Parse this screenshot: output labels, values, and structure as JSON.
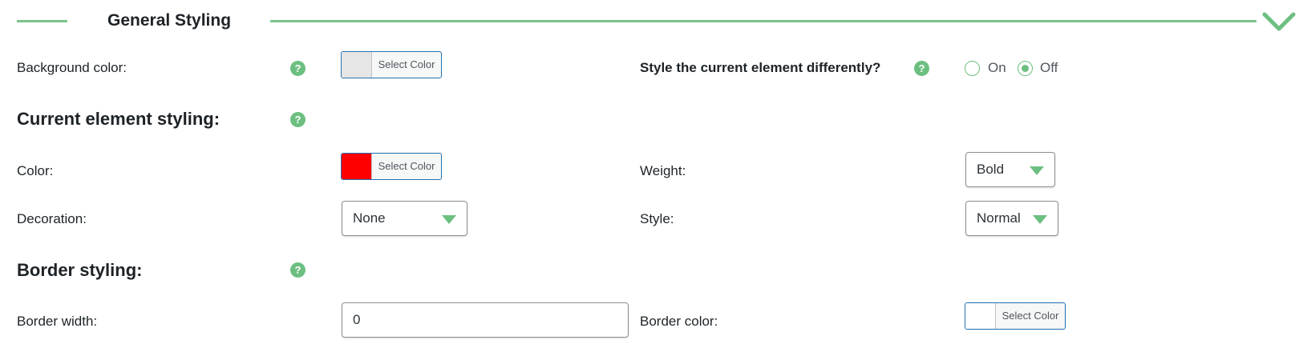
{
  "header": {
    "title": "General Styling",
    "collapse_icon": "chevron-down-icon",
    "accent_color": "#6cbf80"
  },
  "background": {
    "label": "Background color:",
    "button_label": "Select Color",
    "swatch_color": "#e6e6e6",
    "help_icon": "?"
  },
  "style_current": {
    "label": "Style the current element differently?",
    "help_icon": "?",
    "options": [
      {
        "label": "On",
        "checked": false
      },
      {
        "label": "Off",
        "checked": true
      }
    ]
  },
  "current_element": {
    "title": "Current element styling:",
    "help_icon": "?",
    "color_label": "Color:",
    "color_button_label": "Select Color",
    "color_swatch": "#ff0000",
    "weight_label": "Weight:",
    "weight_value": "Bold",
    "decoration_label": "Decoration:",
    "decoration_value": "None",
    "style_label": "Style:",
    "style_value": "Normal"
  },
  "border": {
    "title": "Border styling:",
    "help_icon": "?",
    "width_label": "Border width:",
    "width_value": "0",
    "color_label": "Border color:",
    "color_button_label": "Select Color",
    "color_swatch": "#ffffff"
  }
}
